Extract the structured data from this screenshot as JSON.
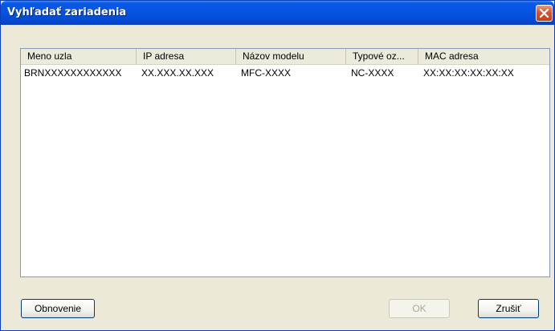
{
  "window": {
    "title": "Vyhľadať zariadenia"
  },
  "table": {
    "columns": [
      "Meno uzla",
      "IP adresa",
      "Názov modelu",
      "Typové oz...",
      "MAC adresa"
    ],
    "rows": [
      [
        "BRNXXXXXXXXXXXX",
        "XX.XXX.XX.XXX",
        "MFC-XXXX",
        "NC-XXXX",
        "XX:XX:XX:XX:XX:XX"
      ]
    ]
  },
  "buttons": {
    "refresh": "Obnovenie",
    "ok": "OK",
    "cancel": "Zrušiť"
  },
  "icons": {
    "close": "close-icon"
  },
  "colors": {
    "titlebar": "#0553e0",
    "close": "#d8542c",
    "dialog_bg": "#ece9d8"
  }
}
